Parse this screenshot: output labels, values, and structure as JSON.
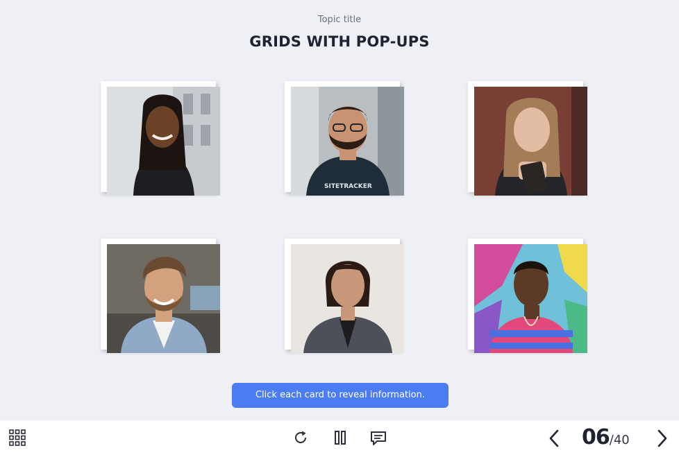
{
  "header": {
    "topic_title": "Topic title",
    "page_title": "GRIDS WITH POP-UPS"
  },
  "cards": [
    {
      "label": "card-1",
      "skin": "#6b4127",
      "hair": "#1b1410",
      "shirt": "#1e1e22",
      "bg": "#d9dcdf"
    },
    {
      "label": "card-2",
      "skin": "#c99273",
      "hair": "#2b1d14",
      "shirt": "#1f2d3a",
      "bg": "#b8bec2"
    },
    {
      "label": "card-3",
      "skin": "#e3bca4",
      "hair": "#a37c58",
      "shirt": "#23252b",
      "bg": "#7a3f34"
    },
    {
      "label": "card-4",
      "skin": "#d4a17f",
      "hair": "#6a4a30",
      "shirt": "#8fa9c6",
      "bg": "#6f6a62"
    },
    {
      "label": "card-5",
      "skin": "#c8987a",
      "hair": "#2a1c15",
      "shirt": "#4d5058",
      "bg": "#e9e5e1"
    },
    {
      "label": "card-6",
      "skin": "#5c3a26",
      "hair": "#1b120e",
      "shirt": "#e2487a",
      "bg": "#6fc0d8"
    }
  ],
  "cta": {
    "label": "Click each card to reveal information."
  },
  "footer": {
    "page_current": "06",
    "page_separator": "/",
    "page_total": "40"
  },
  "colors": {
    "accent": "#4c7cf2",
    "background": "#eef0f6",
    "text_dark": "#1f2230"
  },
  "icons": [
    "menu-grid-icon",
    "replay-icon",
    "pause-icon",
    "comment-icon",
    "chevron-left-icon",
    "chevron-right-icon"
  ]
}
